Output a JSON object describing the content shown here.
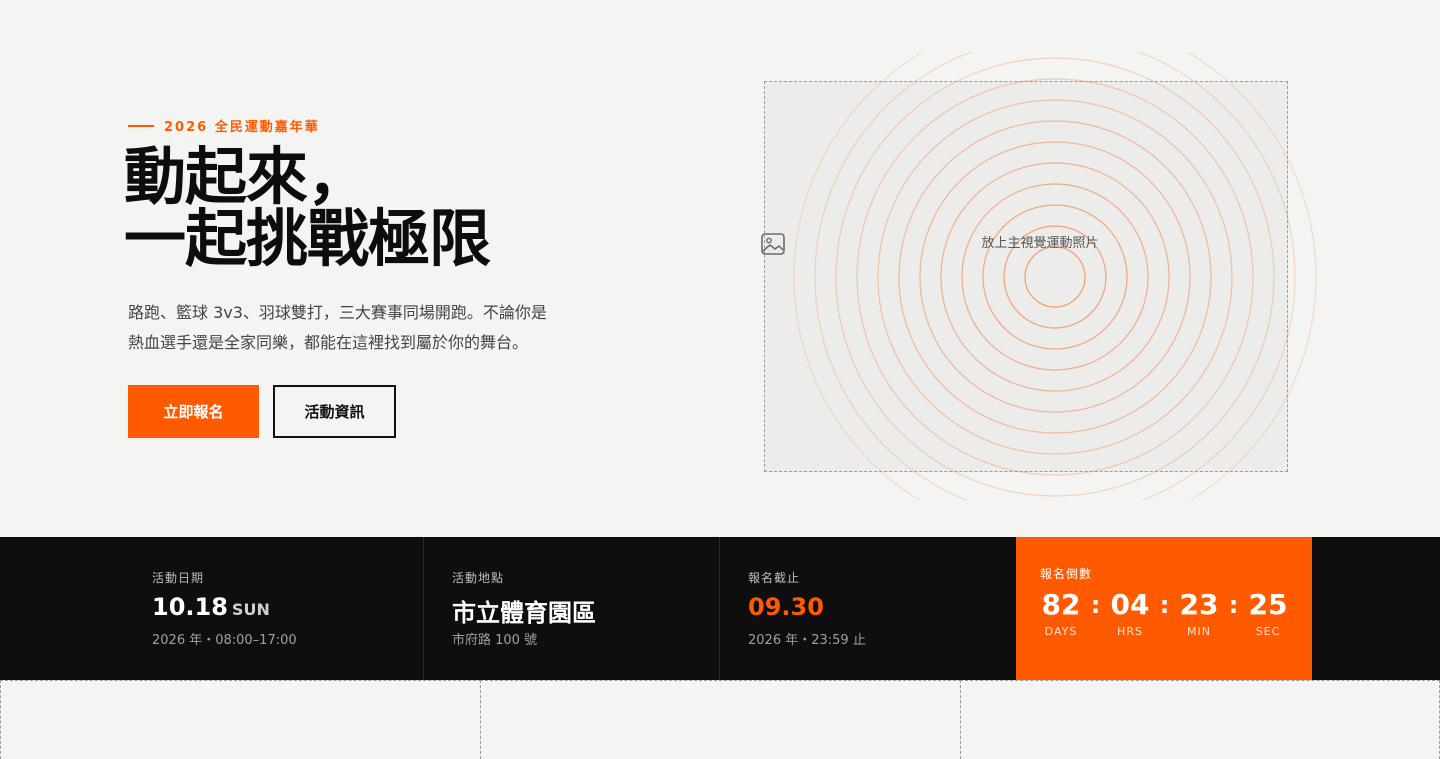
{
  "hero": {
    "eyebrow": "2026 全民運動嘉年華",
    "headline_line1": "動起來，",
    "headline_line2": "一起挑戰極限",
    "lede_line1": "路跑、籃球 3v3、羽球雙打，三大賽事同場開跑。不論你是",
    "lede_line2": "熱血選手還是全家同樂，都能在這裡找到屬於你的舞台。",
    "primary_cta": "立即報名",
    "secondary_cta": "活動資訊",
    "image_placeholder": "放上主視覺運動照片"
  },
  "info": {
    "date": {
      "label": "活動日期",
      "value": "10.18",
      "weekday": "SUN",
      "detail": "2026 年・08:00–17:00"
    },
    "venue": {
      "label": "活動地點",
      "value": "市立體育園區",
      "detail": "市府路 100 號"
    },
    "deadline": {
      "label": "報名截止",
      "value": "09.30",
      "detail": "2026 年・23:59 止"
    }
  },
  "countdown": {
    "label": "報名倒數",
    "units": [
      {
        "value": "82",
        "caption": "DAYS"
      },
      {
        "value": "04",
        "caption": "HRS"
      },
      {
        "value": "23",
        "caption": "MIN"
      },
      {
        "value": "25",
        "caption": "SEC"
      }
    ],
    "separator": ":"
  },
  "colors": {
    "accent": "#ff5a00",
    "background": "#f4f4f2",
    "dark_bar": "#0e0e0e"
  },
  "icons": {
    "image_placeholder": "image-icon"
  }
}
